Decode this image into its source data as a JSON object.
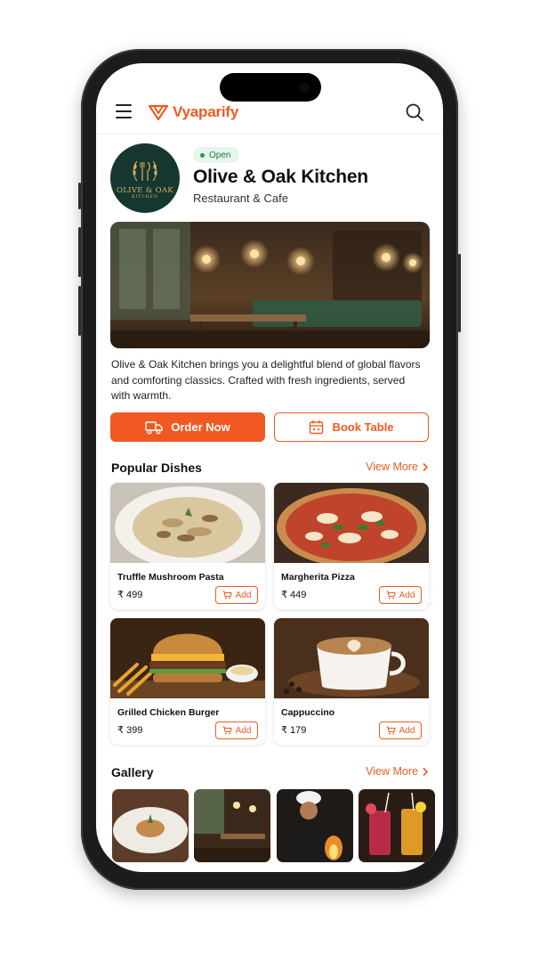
{
  "header": {
    "brand_name": "Vyaparify"
  },
  "restaurant": {
    "logo_text": "OLIVE & OAK",
    "logo_subtext": "KITCHEN",
    "status_badge": "Open",
    "name": "Olive & Oak Kitchen",
    "category": "Restaurant & Cafe",
    "description": "Olive & Oak Kitchen brings you a delightful blend of global flavors and comforting classics. Crafted with fresh ingredients, served with warmth."
  },
  "actions": {
    "order_label": "Order Now",
    "book_label": "Book Table"
  },
  "popular": {
    "title": "Popular Dishes",
    "view_more": "View More",
    "dishes": [
      {
        "name": "Truffle Mushroom Pasta",
        "price": "₹ 499",
        "add_label": "Add"
      },
      {
        "name": "Margherita Pizza",
        "price": "₹ 449",
        "add_label": "Add"
      },
      {
        "name": "Grilled Chicken Burger",
        "price": "₹ 399",
        "add_label": "Add"
      },
      {
        "name": "Cappuccino",
        "price": "₹ 179",
        "add_label": "Add"
      }
    ]
  },
  "gallery": {
    "title": "Gallery",
    "view_more": "View More"
  },
  "colors": {
    "accent": "#f05a22",
    "open_badge_bg": "#e7f6ec",
    "logo_bg": "#16372f"
  }
}
